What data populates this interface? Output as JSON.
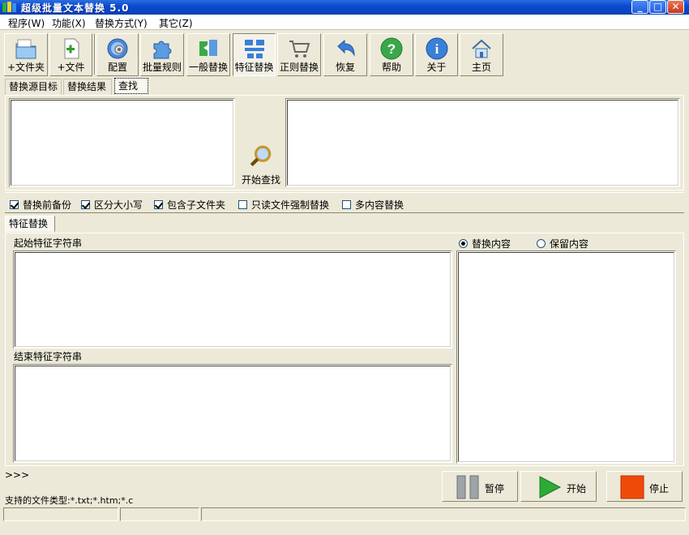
{
  "window": {
    "title": "超级批量文本替换 5.0"
  },
  "menu": [
    "程序(W)",
    "功能(X)",
    "替换方式(Y)",
    "其它(Z)"
  ],
  "toolbar": {
    "add_folder": "+文件夹",
    "add_file": "+文件",
    "config": "配置",
    "batch_rules": "批量规则",
    "general_replace": "一般替换",
    "feature_replace": "特征替换",
    "regex_replace": "正则替换",
    "restore": "恢复",
    "help": "帮助",
    "about": "关于",
    "home": "主页"
  },
  "top_tabs": [
    "替换源目标",
    "替换结果",
    "查找"
  ],
  "find_button": "开始查找",
  "options": {
    "backup": {
      "label": "替换前备份",
      "checked": true
    },
    "case": {
      "label": "区分大小写",
      "checked": true
    },
    "subfolders": {
      "label": "包含子文件夹",
      "checked": true
    },
    "readonly": {
      "label": "只读文件强制替换",
      "checked": false
    },
    "multi": {
      "label": "多内容替换",
      "checked": false
    }
  },
  "bottom_tabs": [
    "特征替换"
  ],
  "feature": {
    "start_label": "起始特征字符串",
    "end_label": "结束特征字符串",
    "radio_replace": "替换内容",
    "radio_keep": "保留内容",
    "selected": "replace"
  },
  "prompt": ">>>",
  "file_types": "支持的文件类型:*.txt;*.htm;*.c",
  "buttons": {
    "pause": "暂停",
    "start": "开始",
    "stop": "停止"
  }
}
